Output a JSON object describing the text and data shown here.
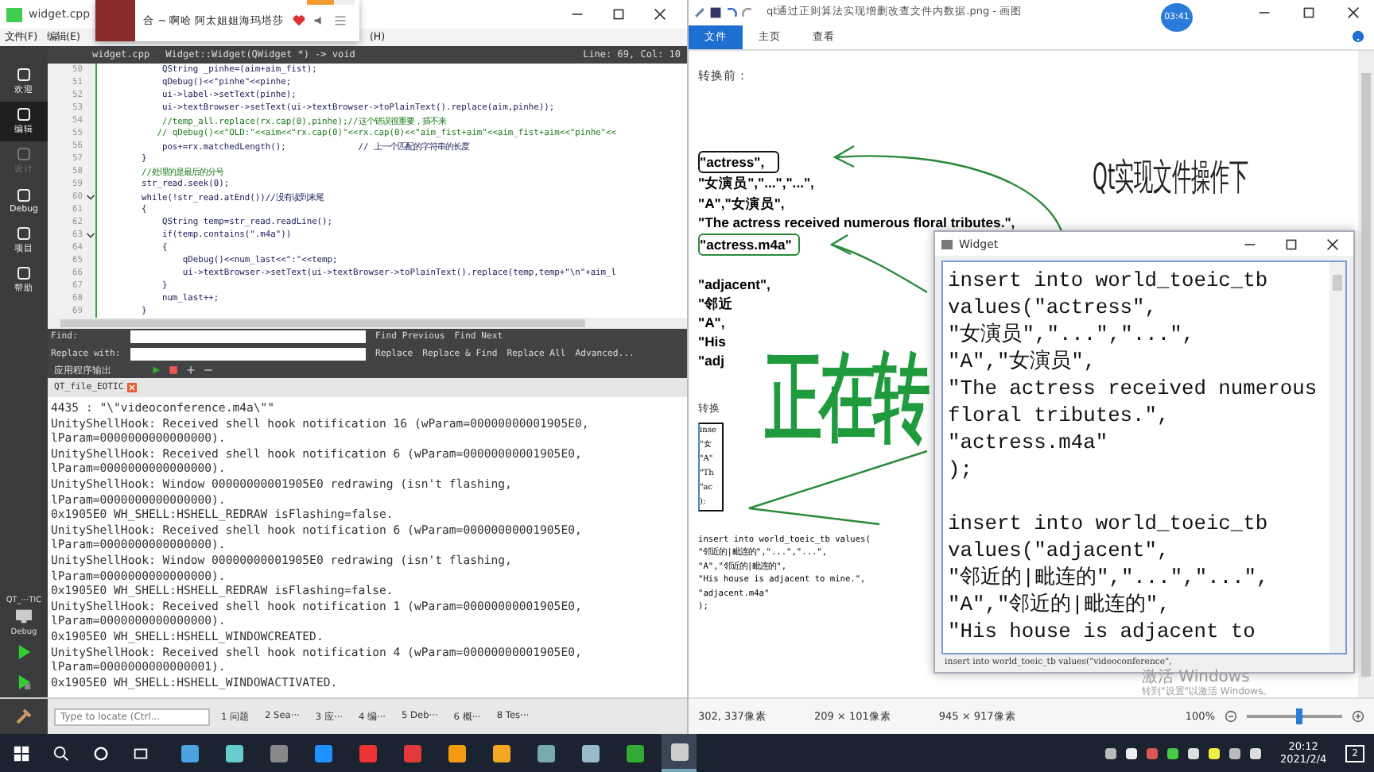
{
  "music_popup": {
    "title": "合 ~ 啊哈 阿太姐姐海玛塔莎",
    "level": 0.55
  },
  "qt_creator": {
    "title": "widget.cpp",
    "menu": [
      "文件(F)",
      "编辑(E)",
      "(H)"
    ],
    "modes": [
      {
        "label": "欢迎",
        "selected": false,
        "disabled": false
      },
      {
        "label": "编辑",
        "selected": true,
        "disabled": false
      },
      {
        "label": "设计",
        "selected": false,
        "disabled": true
      },
      {
        "label": "Debug",
        "selected": false,
        "disabled": false
      },
      {
        "label": "项目",
        "selected": false,
        "disabled": false
      },
      {
        "label": "帮助",
        "selected": false,
        "disabled": false
      }
    ],
    "editor_bar": {
      "file": "widget.cpp",
      "symbol": "Widget::Widget(QWidget *) -> void",
      "position": "Line: 69, Col: 10"
    },
    "code": [
      {
        "line": "50",
        "text": "            QString _pinhe=(aim+aim_fist);",
        "kind": "code",
        "foldable": false
      },
      {
        "line": "51",
        "text": "            qDebug()<<\"pinhe\"<<pinhe;",
        "kind": "code",
        "foldable": false
      },
      {
        "line": "52",
        "text": "            ui->label->setText(pinhe);",
        "kind": "code",
        "foldable": false
      },
      {
        "line": "53",
        "text": "            ui->textBrowser->setText(ui->textBrowser->toPlainText().replace(aim,pinhe));",
        "kind": "code",
        "foldable": false
      },
      {
        "line": "54",
        "text": "            //temp_all.replace(rx.cap(0),pinhe);//这个错误很重要，插不来",
        "kind": "comment",
        "foldable": false
      },
      {
        "line": "55",
        "text": "           // qDebug()<<\"OLD:\"<<aim<<\"rx.cap(0)\"<<rx.cap(0)<<\"aim_fist+aim\"<<aim_fist+aim<<\"pinhe\"<<",
        "kind": "comment",
        "foldable": false
      },
      {
        "line": "56",
        "text": "            pos+=rx.matchedLength();              // 上一个匹配的字符串的长度",
        "kind": "code",
        "foldable": false
      },
      {
        "line": "57",
        "text": "        }",
        "kind": "code",
        "foldable": false
      },
      {
        "line": "58",
        "text": "        //处理的是最后的分号",
        "kind": "comment",
        "foldable": false
      },
      {
        "line": "59",
        "text": "        str_read.seek(0);",
        "kind": "code",
        "foldable": false
      },
      {
        "line": "60",
        "text": "        while(!str_read.atEnd())//没有读到末尾",
        "kind": "code",
        "foldable": true
      },
      {
        "line": "61",
        "text": "        {",
        "kind": "code",
        "foldable": false
      },
      {
        "line": "62",
        "text": "            QString temp=str_read.readLine();",
        "kind": "code",
        "foldable": false
      },
      {
        "line": "63",
        "text": "            if(temp.contains(\".m4a\"))",
        "kind": "code",
        "foldable": true
      },
      {
        "line": "64",
        "text": "            {",
        "kind": "code",
        "foldable": false
      },
      {
        "line": "65",
        "text": "                qDebug()<<num_last<<\":\"<<temp;",
        "kind": "code",
        "foldable": false
      },
      {
        "line": "66",
        "text": "                ui->textBrowser->setText(ui->textBrowser->toPlainText().replace(temp,temp+\"\\n\"+aim_l",
        "kind": "code",
        "foldable": false
      },
      {
        "line": "67",
        "text": "            }",
        "kind": "code",
        "foldable": false
      },
      {
        "line": "68",
        "text": "            num_last++;",
        "kind": "code",
        "foldable": false
      },
      {
        "line": "69",
        "text": "        }",
        "kind": "code",
        "foldable": false
      }
    ],
    "find_bar": {
      "find_label": "Find:",
      "replace_label": "Replace with:",
      "buttons": [
        "Find Previous",
        "Find Next"
      ],
      "replace_buttons": [
        "Replace",
        "Replace & Find",
        "Replace All",
        "Advanced..."
      ]
    },
    "output": {
      "title": "应用程序输出",
      "tab": "QT_file_EOTIC",
      "lines": [
        "4435 : \"\\\"videoconference.m4a\\\"\"",
        "UnityShellHook: Received shell hook notification 16 (wParam=00000000001905E0,",
        "lParam=0000000000000000).",
        "UnityShellHook: Received shell hook notification 6 (wParam=00000000001905E0,",
        "lParam=0000000000000000).",
        "UnityShellHook: Window 00000000001905E0 redrawing (isn't flashing,",
        "lParam=0000000000000000).",
        "0x1905E0 WH_SHELL:HSHELL_REDRAW isFlashing=false.",
        "UnityShellHook: Received shell hook notification 6 (wParam=00000000001905E0,",
        "lParam=0000000000000000).",
        "UnityShellHook: Window 00000000001905E0 redrawing (isn't flashing,",
        "lParam=0000000000000000).",
        "0x1905E0 WH_SHELL:HSHELL_REDRAW isFlashing=false.",
        "UnityShellHook: Received shell hook notification 1 (wParam=00000000001905E0,",
        "lParam=0000000000000000).",
        "0x1905E0 WH_SHELL:HSHELL_WINDOWCREATED.",
        "UnityShellHook: Received shell hook notification 4 (wParam=00000000001905E0,",
        "lParam=0000000000000001).",
        "0x1905E0 WH_SHELL:HSHELL_WINDOWACTIVATED."
      ]
    },
    "run_target": {
      "project": "QT_···TIC",
      "build": "Debug"
    },
    "locator": {
      "placeholder": "Type to locate (Ctrl..."
    },
    "panes": [
      "1 问题",
      "2 Sea···",
      "3 应···",
      "4 编···",
      "5 Deb···",
      "6 概···",
      "8 Tes···"
    ]
  },
  "paint": {
    "title": "qt通过正则算法实现增删改查文件内数据.png - 画图",
    "badge": "03:41",
    "tabs": [
      {
        "label": "文件",
        "selected": true
      },
      {
        "label": "主页",
        "selected": false
      },
      {
        "label": "查看",
        "selected": false
      }
    ],
    "image": {
      "heading": "转换前：",
      "before_lines": [
        {
          "text": "\"actress\",",
          "kind": "boxed-dark"
        },
        {
          "text": "\"女演员\",\"...\",\"...\",",
          "kind": "plain"
        },
        {
          "text": "\"A\",\"女演员\",",
          "kind": "plain"
        },
        {
          "text": "\"The actress received numerous floral tributes.\",",
          "kind": "plain"
        },
        {
          "text": "\"actress.m4a\"",
          "kind": "boxed-green"
        }
      ],
      "title_art": "Qt实现文件操作下",
      "second_lines": [
        "\"adjacent\",",
        "\"邻近",
        "\"A\",",
        "\"His",
        "\"adj"
      ],
      "overlay": "正在转",
      "after_heading": "转换",
      "snippet_lines": [
        "inse",
        "\"女",
        "\"A\"",
        "\"Th",
        "\"ac",
        ");"
      ],
      "after_lines": [
        "insert into world_toeic_tb values(",
        "\"邻近的|毗连的\",\"...\",\"...\",",
        "\"A\",\"邻近的|毗连的\",",
        "\"His house is adjacent to mine.\",",
        "\"adjacent.m4a\"",
        ");"
      ]
    },
    "status": {
      "cursor": "302, 337像素",
      "selection": "209 × 101像素",
      "size": "945 × 917像素",
      "zoom": "100%",
      "level": 0.55
    }
  },
  "widget": {
    "title": "Widget",
    "records": [
      [
        "insert into world_toeic_tb",
        "values(\"actress\",",
        "\"女演员\",\"...\",\"...\",",
        "\"A\",\"女演员\",",
        "\"The actress received numerous",
        "floral tributes.\",",
        "\"actress.m4a\"",
        ");"
      ],
      [
        "insert into world_toeic_tb",
        "values(\"adjacent\",",
        "\"邻近的|毗连的\",\"...\",\"...\",",
        "\"A\",\"邻近的|毗连的\",",
        "\"His house is adjacent to"
      ]
    ],
    "footer": "insert into world_toeic_tb values(\"videoconference\","
  },
  "activation": {
    "title": "激活 Windows",
    "hint": "转到\"设置\"以激活 Windows。"
  },
  "taskbar": {
    "time": "20:12",
    "date": "2021/2/4",
    "notifications": "2"
  }
}
